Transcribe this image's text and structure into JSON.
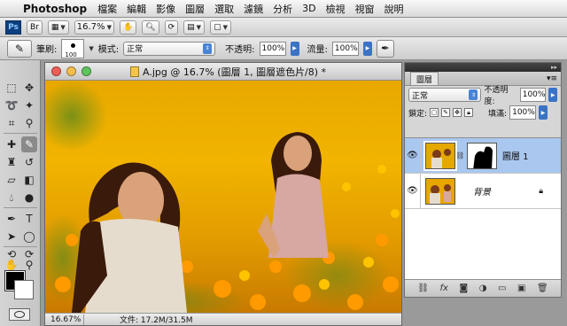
{
  "menubar": {
    "app": "Photoshop",
    "items": [
      "檔案",
      "編輯",
      "影像",
      "圖層",
      "選取",
      "濾鏡",
      "分析",
      "3D",
      "檢視",
      "視窗",
      "說明"
    ]
  },
  "appbar": {
    "logo": "Ps",
    "bridge": "Br",
    "zoom": "16.7%"
  },
  "options": {
    "brush_label": "筆刷:",
    "brush_size": "100",
    "mode_label": "模式:",
    "mode_value": "正常",
    "opacity_label": "不透明:",
    "opacity_value": "100%",
    "flow_label": "流量:",
    "flow_value": "100%"
  },
  "document": {
    "title": "A.jpg @ 16.7% (圖層 1, 圖層遮色片/8) *",
    "zoom": "16.67%",
    "size": "文件: 17.2M/31.5M"
  },
  "layers_panel": {
    "tab": "圖層",
    "blend_mode": "正常",
    "opacity_label": "不透明度:",
    "opacity_value": "100%",
    "lock_label": "鎖定:",
    "fill_label": "填滿:",
    "fill_value": "100%",
    "layers": [
      {
        "name": "圖層 1",
        "selected": true
      },
      {
        "name": "背景",
        "selected": false
      }
    ]
  },
  "colors": {
    "accent": "#3a73c6",
    "selected_layer": "#a9c7ef",
    "close": "#ec5f57",
    "minimize": "#f4be4f",
    "zoom": "#5fc45c"
  },
  "icons": {
    "apple": "apple-icon",
    "hand": "hand-icon",
    "zoom": "zoom-tool-icon",
    "brush": "brush-icon",
    "eye": "eye-icon"
  }
}
